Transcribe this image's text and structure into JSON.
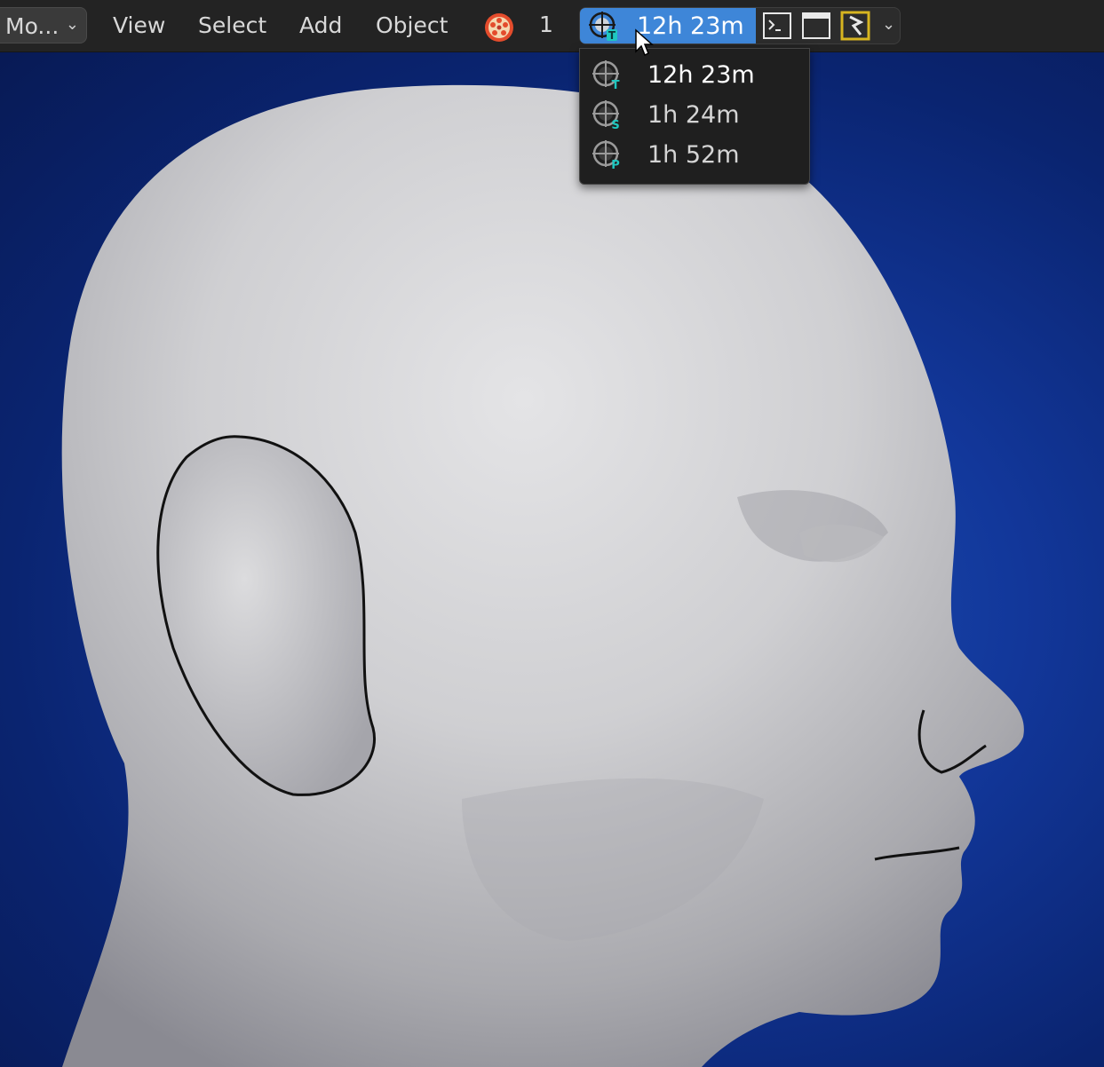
{
  "menubar": {
    "mode_label": "Mo...",
    "menu_items": [
      "View",
      "Select",
      "Add",
      "Object"
    ],
    "frame_number": "1",
    "timer_value": "12h 23m"
  },
  "dropdown": {
    "items": [
      {
        "label": "12h 23m",
        "badge": "T",
        "color": "#ffffff"
      },
      {
        "label": "1h 24m",
        "badge": "S",
        "color": "#d4d4d4"
      },
      {
        "label": "1h 52m",
        "badge": "P",
        "color": "#d4d4d4"
      }
    ]
  },
  "colors": {
    "accent": "#3e86d8",
    "badge": "#1fc7c0",
    "background": "#12379a"
  }
}
